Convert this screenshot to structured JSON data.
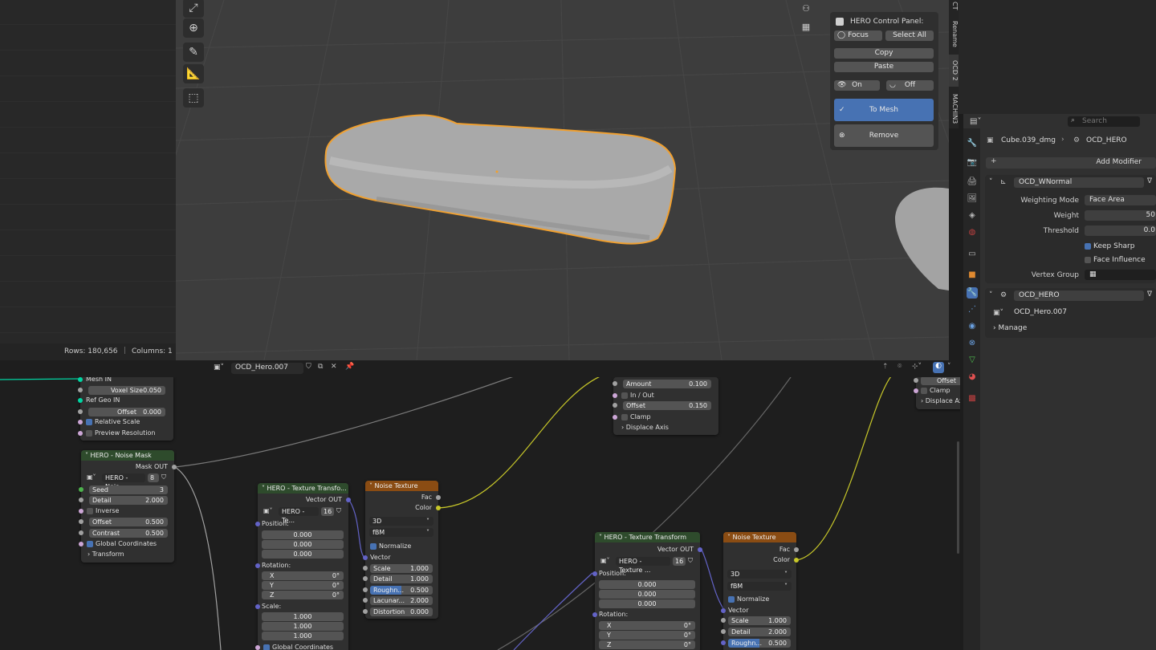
{
  "outliner": {
    "rows_label": "Rows: 180,656",
    "columns_label": "Columns: 1"
  },
  "hero_panel": {
    "title": "HERO Control Panel:",
    "focus": "Focus",
    "select_all": "Select All",
    "copy": "Copy",
    "paste": "Paste",
    "on": "On",
    "off": "Off",
    "to_mesh": "To Mesh",
    "remove": "Remove"
  },
  "side_tabs": [
    "CT",
    "Rename",
    "OCD 2",
    "MACHIN3"
  ],
  "properties": {
    "search_placeholder": "Search",
    "object_name": "Cube.039_dmg",
    "modifier_ref": "OCD_HERO",
    "add_modifier": "Add Modifier",
    "wnormal": {
      "name": "OCD_WNormal",
      "weighting_mode_label": "Weighting Mode",
      "weighting_mode": "Face Area",
      "weight_label": "Weight",
      "weight": "50",
      "threshold_label": "Threshold",
      "threshold": "0.0",
      "keep_sharp": "Keep Sharp",
      "face_influence": "Face Influence",
      "vertex_group_label": "Vertex Group"
    },
    "hero": {
      "name": "OCD_HERO",
      "nodegroup": "OCD_Hero.007",
      "manage": "Manage"
    }
  },
  "node_editor": {
    "tree_name": "OCD_Hero.007",
    "group_input": {
      "mesh_in": "Mesh IN",
      "voxel_size_label": "Voxel Size",
      "voxel_size": "0.050",
      "ref_geo_in": "Ref Geo IN",
      "offset_label": "Offset",
      "offset": "0.000",
      "relative_scale": "Relative Scale",
      "preview_resolution": "Preview Resolution"
    },
    "noise_mask": {
      "title": "HERO - Noise Mask",
      "out": "Mask OUT",
      "group": "HERO - Nois...",
      "users": "8",
      "seed_label": "Seed",
      "seed": "3",
      "detail_label": "Detail",
      "detail": "2.000",
      "inverse": "Inverse",
      "offset_label": "Offset",
      "offset": "0.500",
      "contrast_label": "Contrast",
      "contrast": "0.500",
      "global_coords": "Global Coordinates",
      "transform": "Transform"
    },
    "tex_transform_1": {
      "title": "HERO - Texture Transfo...",
      "out": "Vector OUT",
      "group": "HERO - Te...",
      "users": "16",
      "position_label": "Position:",
      "position": [
        "0.000",
        "0.000",
        "0.000"
      ],
      "rotation_label": "Rotation:",
      "rotation": [
        [
          "X",
          "0°"
        ],
        [
          "Y",
          "0°"
        ],
        [
          "Z",
          "0°"
        ]
      ],
      "scale_label": "Scale:",
      "scale": [
        "1.000",
        "1.000",
        "1.000"
      ],
      "global_coords": "Global Coordinates"
    },
    "noise_tex_1": {
      "title": "Noise Texture",
      "fac": "Fac",
      "color": "Color",
      "dim": "3D",
      "type": "fBM",
      "normalize": "Normalize",
      "vector": "Vector",
      "scale_label": "Scale",
      "scale": "1.000",
      "detail_label": "Detail",
      "detail": "1.000",
      "rough_label": "Roughn...",
      "rough": "0.500",
      "lacunarity_label": "Lacunar...",
      "lacunarity": "2.000",
      "distortion_label": "Distortion",
      "distortion": "0.000"
    },
    "displace": {
      "amount_label": "Amount",
      "amount": "0.100",
      "in_out": "In / Out",
      "offset_label": "Offset",
      "offset": "0.150",
      "clamp": "Clamp",
      "axis": "Displace Axis"
    },
    "displace_right": {
      "offset": "Offset",
      "clamp": "Clamp",
      "axis": "Displace Ax"
    },
    "tex_transform_2": {
      "title": "HERO - Texture Transform",
      "out": "Vector OUT",
      "group": "HERO - Texture ...",
      "users": "16",
      "position_label": "Position:",
      "position": [
        "0.000",
        "0.000",
        "0.000"
      ],
      "rotation_label": "Rotation:",
      "rotation": [
        [
          "X",
          "0°"
        ],
        [
          "Y",
          "0°"
        ],
        [
          "Z",
          "0°"
        ]
      ]
    },
    "noise_tex_2": {
      "title": "Noise Texture",
      "fac": "Fac",
      "color": "Color",
      "dim": "3D",
      "type": "fBM",
      "normalize": "Normalize",
      "vector": "Vector",
      "scale_label": "Scale",
      "scale": "1.000",
      "detail_label": "Detail",
      "detail": "2.000",
      "rough_label": "Roughn...",
      "rough": "0.500"
    }
  },
  "colors": {
    "accent": "#4772b3",
    "selection_outline": "#f0a030",
    "group_header": "#2e4b2c",
    "texture_header": "#8a4c13",
    "vector_socket": "#6363c7",
    "float_socket": "#a1a1a1",
    "color_socket": "#c7c729",
    "geometry_socket": "#00d6a3"
  }
}
